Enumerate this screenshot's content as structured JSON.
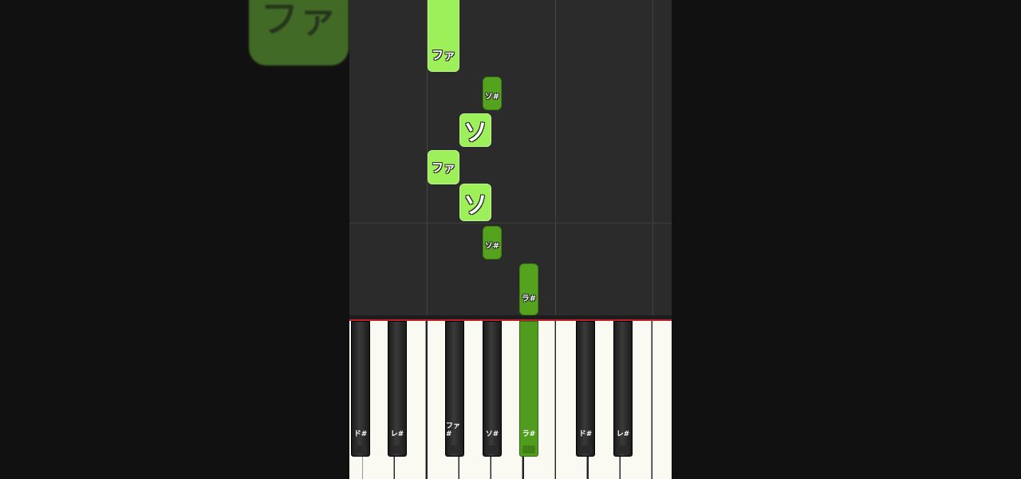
{
  "background_note": {
    "label": "ファ"
  },
  "falling_notes": [
    {
      "label": "ファ",
      "kind": "white"
    },
    {
      "label": "ソ#",
      "kind": "black"
    },
    {
      "label": "ソ",
      "kind": "white-big"
    },
    {
      "label": "ファ",
      "kind": "white"
    },
    {
      "label": "ソ",
      "kind": "white-big"
    },
    {
      "label": "ソ#",
      "kind": "black"
    },
    {
      "label": "ラ#",
      "kind": "black"
    }
  ],
  "black_keys": [
    {
      "label": "ド#",
      "active": false
    },
    {
      "label": "レ#",
      "active": false
    },
    {
      "label": "ファ#",
      "active": false
    },
    {
      "label": "ソ#",
      "active": false
    },
    {
      "label": "ラ#",
      "active": true
    },
    {
      "label": "ド#",
      "active": false
    },
    {
      "label": "レ#",
      "active": false
    }
  ],
  "colors": {
    "white_note": "#9df05a",
    "black_note": "#55a21f",
    "hit_line": "#c0202a",
    "active_key": "#4f9c1e"
  }
}
